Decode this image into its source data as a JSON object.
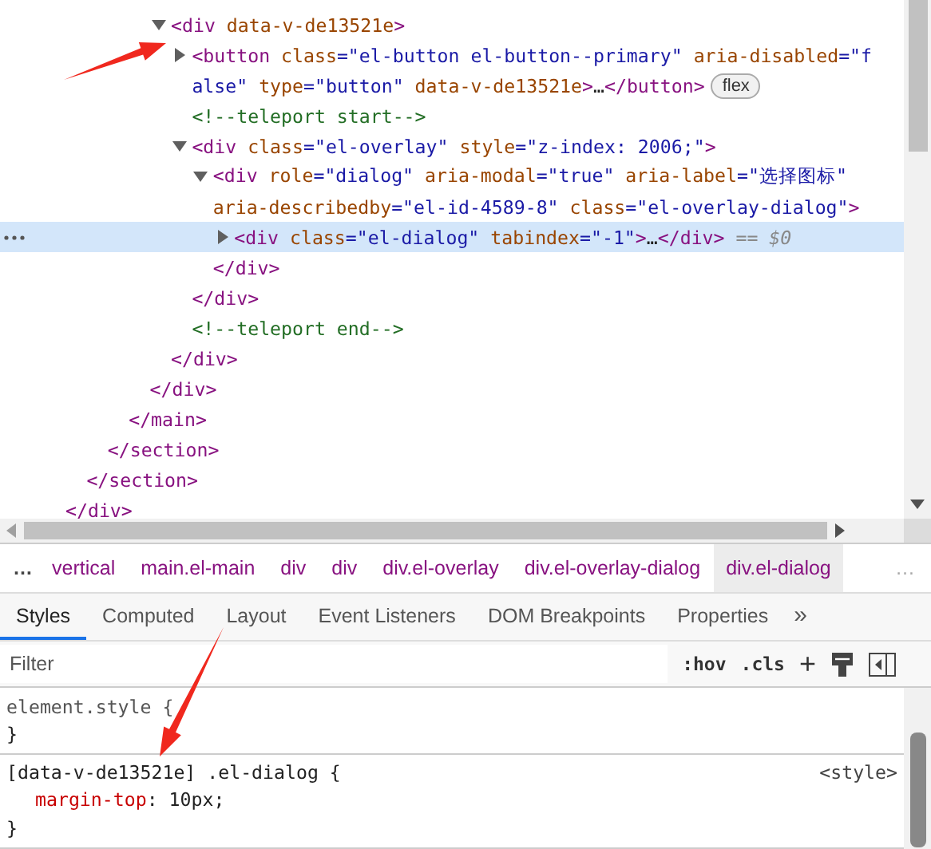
{
  "dom_tree": {
    "nodes": [
      {
        "selected": false,
        "close": [
          {
            "kind": "tag",
            "text": "</div>"
          }
        ],
        "children": [
          {
            "selected": false,
            "close": [
              {
                "kind": "tag",
                "text": "</section>"
              }
            ],
            "children": [
              {
                "selected": false,
                "close": [
                  {
                    "kind": "tag",
                    "text": "</section>"
                  }
                ],
                "children": [
                  {
                    "selected": false,
                    "close": [
                      {
                        "kind": "tag",
                        "text": "</main>"
                      }
                    ],
                    "children": [
                      {
                        "selected": false,
                        "close": [
                          {
                            "kind": "tag",
                            "text": "</div>"
                          }
                        ],
                        "children": [
                          {
                            "expanded": true,
                            "selected": false,
                            "open": [
                              [
                                {
                                  "kind": "tag",
                                  "text": "<div"
                                },
                                {
                                  "kind": "attr",
                                  "text": " data-v-de13521e"
                                },
                                {
                                  "kind": "tag",
                                  "text": ">"
                                }
                              ]
                            ],
                            "close": [
                              {
                                "kind": "tag",
                                "text": "</div>"
                              }
                            ],
                            "children": [
                              {
                                "expanded": false,
                                "selected": false,
                                "badge": "flex",
                                "open": [
                                  [
                                    {
                                      "kind": "tag",
                                      "text": "<button"
                                    },
                                    {
                                      "kind": "attr",
                                      "text": " class"
                                    },
                                    {
                                      "kind": "value",
                                      "text": "=\"el-button el-button--primary\""
                                    },
                                    {
                                      "kind": "attr",
                                      "text": " aria-disabled"
                                    },
                                    {
                                      "kind": "value",
                                      "text": "=\"f"
                                    }
                                  ],
                                  [
                                    {
                                      "kind": "value",
                                      "text": "alse\""
                                    },
                                    {
                                      "kind": "attr",
                                      "text": " type"
                                    },
                                    {
                                      "kind": "value",
                                      "text": "=\"button\""
                                    },
                                    {
                                      "kind": "attr",
                                      "text": " data-v-de13521e"
                                    },
                                    {
                                      "kind": "tag",
                                      "text": ">"
                                    },
                                    {
                                      "kind": "plain",
                                      "text": "…"
                                    },
                                    {
                                      "kind": "tag",
                                      "text": "</button>"
                                    }
                                  ]
                                ]
                              },
                              {
                                "selected": false,
                                "open": [
                                  [
                                    {
                                      "kind": "comment",
                                      "text": "<!--teleport start-->"
                                    }
                                  ]
                                ]
                              },
                              {
                                "expanded": true,
                                "selected": false,
                                "open": [
                                  [
                                    {
                                      "kind": "tag",
                                      "text": "<div"
                                    },
                                    {
                                      "kind": "attr",
                                      "text": " class"
                                    },
                                    {
                                      "kind": "value",
                                      "text": "=\"el-overlay\""
                                    },
                                    {
                                      "kind": "attr",
                                      "text": " style"
                                    },
                                    {
                                      "kind": "value",
                                      "text": "=\"z-index: 2006;\""
                                    },
                                    {
                                      "kind": "tag",
                                      "text": ">"
                                    }
                                  ]
                                ],
                                "close": [
                                  {
                                    "kind": "tag",
                                    "text": "</div>"
                                  }
                                ],
                                "children": [
                                  {
                                    "expanded": true,
                                    "selected": false,
                                    "open": [
                                      [
                                        {
                                          "kind": "tag",
                                          "text": "<div"
                                        },
                                        {
                                          "kind": "attr",
                                          "text": " role"
                                        },
                                        {
                                          "kind": "value",
                                          "text": "=\"dialog\""
                                        },
                                        {
                                          "kind": "attr",
                                          "text": " aria-modal"
                                        },
                                        {
                                          "kind": "value",
                                          "text": "=\"true\""
                                        },
                                        {
                                          "kind": "attr",
                                          "text": " aria-label"
                                        },
                                        {
                                          "kind": "value",
                                          "text": "=\"选择图标\""
                                        }
                                      ],
                                      [
                                        {
                                          "kind": "attr",
                                          "text": "aria-describedby"
                                        },
                                        {
                                          "kind": "value",
                                          "text": "=\"el-id-4589-8\""
                                        },
                                        {
                                          "kind": "attr",
                                          "text": " class"
                                        },
                                        {
                                          "kind": "value",
                                          "text": "=\"el-overlay-dialog\""
                                        },
                                        {
                                          "kind": "tag",
                                          "text": ">"
                                        }
                                      ]
                                    ],
                                    "close": [
                                      {
                                        "kind": "tag",
                                        "text": "</div>"
                                      }
                                    ],
                                    "children": [
                                      {
                                        "expanded": false,
                                        "selected": true,
                                        "open": [
                                          [
                                            {
                                              "kind": "tag",
                                              "text": "<div"
                                            },
                                            {
                                              "kind": "attr",
                                              "text": " class"
                                            },
                                            {
                                              "kind": "value",
                                              "text": "=\"el-dialog\""
                                            },
                                            {
                                              "kind": "attr",
                                              "text": " tabindex"
                                            },
                                            {
                                              "kind": "value",
                                              "text": "=\"-1\""
                                            },
                                            {
                                              "kind": "tag",
                                              "text": ">"
                                            },
                                            {
                                              "kind": "plain",
                                              "text": "…"
                                            },
                                            {
                                              "kind": "tag",
                                              "text": "</div>"
                                            },
                                            {
                                              "kind": "hint",
                                              "text": " == $0"
                                            }
                                          ]
                                        ]
                                      }
                                    ]
                                  }
                                ]
                              },
                              {
                                "selected": false,
                                "open": [
                                  [
                                    {
                                      "kind": "comment",
                                      "text": "<!--teleport end-->"
                                    }
                                  ]
                                ]
                              }
                            ]
                          }
                        ]
                      }
                    ]
                  }
                ]
              }
            ]
          }
        ]
      }
    ]
  },
  "breadcrumbs": {
    "leading": "…",
    "trailing": "…",
    "items": [
      {
        "text": "vertical",
        "selected": false
      },
      {
        "text": "main.el-main",
        "selected": false
      },
      {
        "text": "div",
        "selected": false
      },
      {
        "text": "div",
        "selected": false
      },
      {
        "text": "div.el-overlay",
        "selected": false
      },
      {
        "text": "div.el-overlay-dialog",
        "selected": false
      },
      {
        "text": "div.el-dialog",
        "selected": true
      }
    ]
  },
  "tabs": [
    {
      "label": "Styles",
      "selected": true
    },
    {
      "label": "Computed",
      "selected": false
    },
    {
      "label": "Layout",
      "selected": false
    },
    {
      "label": "Event Listeners",
      "selected": false
    },
    {
      "label": "DOM Breakpoints",
      "selected": false
    },
    {
      "label": "Properties",
      "selected": false
    }
  ],
  "tabs_overflow": "»",
  "filter": {
    "placeholder": "Filter",
    "hov": ":hov",
    "cls": ".cls",
    "add": "+"
  },
  "rules": [
    {
      "selector": "element.style {",
      "inline": true,
      "close": "}"
    },
    {
      "selector": "[data-v-de13521e] .el-dialog {",
      "inline": false,
      "source": "<style>",
      "declarations": [
        {
          "property": "margin-top",
          "value": ": 10px;"
        }
      ],
      "close": "}"
    }
  ]
}
